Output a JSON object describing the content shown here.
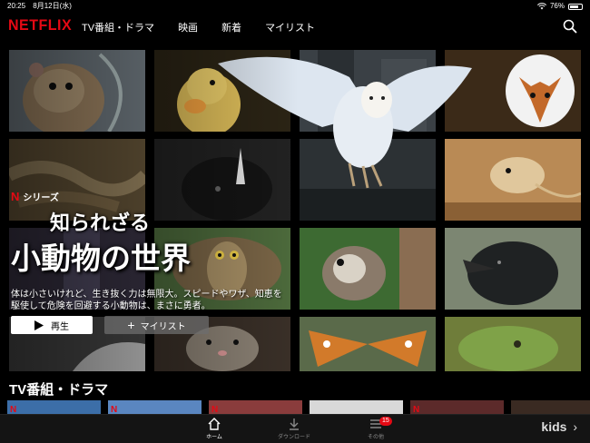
{
  "status_bar": {
    "time": "20:25",
    "date": "8月12日(水)",
    "battery": "76%",
    "battery_level": 0.76
  },
  "app": {
    "logo": "NETFLIX"
  },
  "nav": {
    "items": [
      "TV番組・ドラマ",
      "映画",
      "新着",
      "マイリスト"
    ],
    "search_icon": "search-icon"
  },
  "hero": {
    "badge_n": "N",
    "badge_label": "シリーズ",
    "title_line1": "知られざる",
    "title_line2": "小動物の世界",
    "description": "体は小さいけれど、生き抜く力は無限大。スピードやワザ、知恵を駆使して危険を回避する小動物は、まさに勇者。",
    "play_label": "再生",
    "mylist_label": "マイリスト"
  },
  "section": {
    "title": "TV番組・ドラマ"
  },
  "tabbar": {
    "tabs": [
      {
        "label": "ホーム",
        "icon": "home-icon"
      },
      {
        "label": "ダウンロード",
        "icon": "download-icon"
      },
      {
        "label": "その他",
        "icon": "menu-icon"
      }
    ],
    "badge_count": "15"
  },
  "kids": {
    "label": "kids",
    "arrow": "›"
  },
  "colors": {
    "brand": "#e50914",
    "background": "#000000"
  }
}
